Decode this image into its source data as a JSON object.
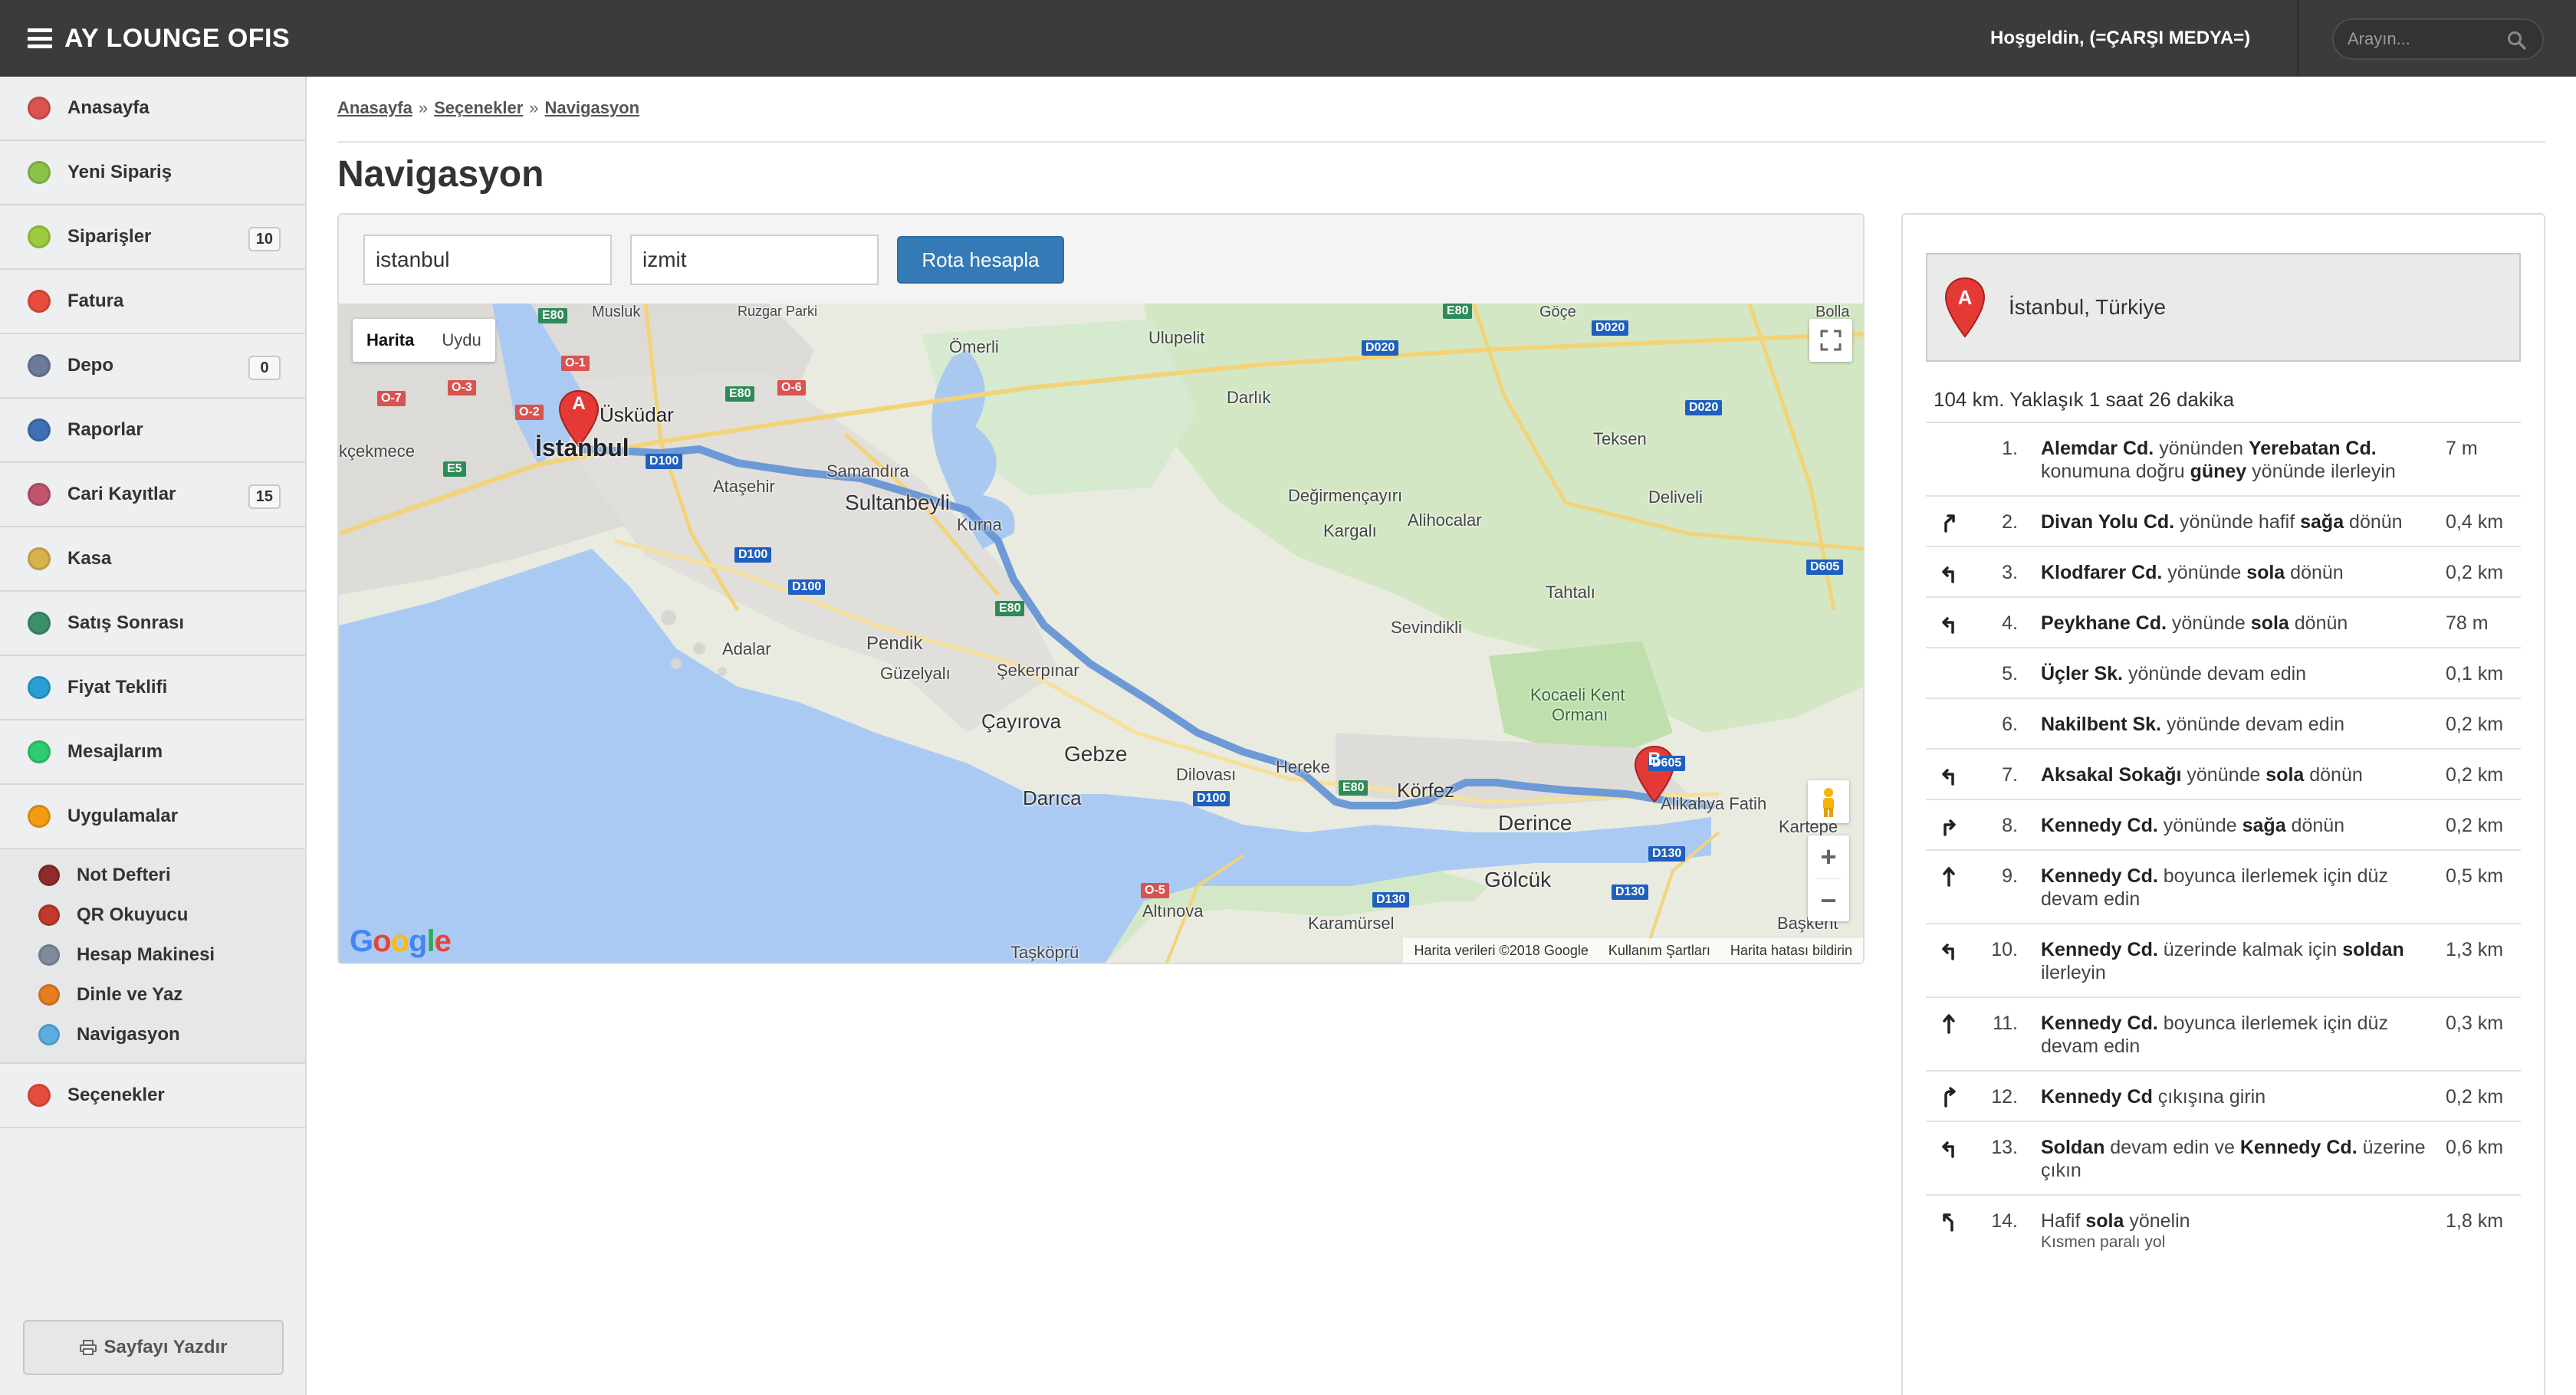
{
  "app": {
    "title": "AY LOUNGE OFIS",
    "welcome": "Hoşgeldin, (=ÇARŞI MEDYA=)",
    "search_placeholder": "Arayın..."
  },
  "sidebar": {
    "items": [
      {
        "label": "Anasayfa",
        "icon": "home-icon",
        "color": "#d9534f"
      },
      {
        "label": "Yeni Sipariş",
        "icon": "new-order-icon",
        "color": "#8bc34a"
      },
      {
        "label": "Siparişler",
        "icon": "orders-icon",
        "color": "#9ccc3d",
        "badge": "10"
      },
      {
        "label": "Fatura",
        "icon": "invoice-icon",
        "color": "#e74c3c"
      },
      {
        "label": "Depo",
        "icon": "warehouse-icon",
        "color": "#6c7a9c",
        "badge": "0"
      },
      {
        "label": "Raporlar",
        "icon": "reports-icon",
        "color": "#3f6fb5"
      },
      {
        "label": "Cari Kayıtlar",
        "icon": "accounts-icon",
        "color": "#c0546b",
        "badge": "15"
      },
      {
        "label": "Kasa",
        "icon": "cash-icon",
        "color": "#d8b24c"
      },
      {
        "label": "Satış Sonrası",
        "icon": "after-sales-icon",
        "color": "#3b8f6b"
      },
      {
        "label": "Fiyat Teklifi",
        "icon": "price-quote-icon",
        "color": "#2a9fd6"
      },
      {
        "label": "Mesajlarım",
        "icon": "messages-icon",
        "color": "#2ecc71"
      },
      {
        "label": "Uygulamalar",
        "icon": "apps-icon",
        "color": "#f39c12"
      }
    ],
    "sub_items": [
      {
        "label": "Not Defteri",
        "icon": "notebook-icon",
        "color": "#8e2b2b"
      },
      {
        "label": "QR Okuyucu",
        "icon": "qr-reader-icon",
        "color": "#c0392b"
      },
      {
        "label": "Hesap Makinesi",
        "icon": "calculator-icon",
        "color": "#7f8c9b"
      },
      {
        "label": "Dinle ve Yaz",
        "icon": "listen-write-icon",
        "color": "#e67e22"
      },
      {
        "label": "Navigasyon",
        "icon": "navigation-icon",
        "color": "#5dade2"
      }
    ],
    "settings_label": "Seçenekler",
    "settings_color": "#e74c3c",
    "print_label": "Sayfayı Yazdır"
  },
  "breadcrumb": [
    "Anasayfa",
    "Seçenekler",
    "Navigasyon"
  ],
  "page_title": "Navigasyon",
  "route_form": {
    "origin": "istanbul",
    "destination": "izmit",
    "button": "Rota hesapla"
  },
  "map": {
    "type_map": "Harita",
    "type_satellite": "Uydu",
    "google": "Google",
    "footer": [
      "Harita verileri ©2018 Google",
      "Kullanım Şartları",
      "Harita hatası bildirin"
    ],
    "marker_a": "A",
    "marker_b": "B",
    "places": {
      "istanbul": "İstanbul",
      "uskudar": "Üsküdar",
      "cekmece": "kçekmece",
      "atasehir": "Ataşehir",
      "samandira": "Samandıra",
      "sultanbeyli": "Sultanbeyli",
      "kurna": "Kurna",
      "omerli": "Ömerli",
      "ulupelit": "Ulupelit",
      "darlik": "Darlık",
      "goce": "Göçe",
      "teksen": "Teksen",
      "degirmencayiri": "Değirmençayırı",
      "kargali": "Kargalı",
      "alihocalar": "Alihocalar",
      "deliveli": "Deliveli",
      "tahtali": "Tahtalı",
      "sevindikli": "Sevindikli",
      "pendik": "Pendik",
      "adalar": "Adalar",
      "guzelyali": "Güzelyalı",
      "sekerpinar": "Şekerpınar",
      "cayirova": "Çayırova",
      "gebze": "Gebze",
      "darica": "Darıca",
      "dilovasi": "Dilovası",
      "hereke": "Hereke",
      "korfez": "Körfez",
      "derince": "Derince",
      "kocaeli": "Kocaeli Kent",
      "ormani": "Ormanı",
      "alikahya": "Alikahya Fatih",
      "kartepe": "Kartepe",
      "golcuk": "Gölcük",
      "altinova": "Altınova",
      "karamursel": "Karamürsel",
      "taskopru": "Taşköprü",
      "baskent": "Başkent",
      "bolla": "Bolla",
      "ruzgar": "Ruzgar Parki",
      "musluk": "Musluk"
    },
    "roads": {
      "e80a": "E80",
      "e80b": "E80",
      "e80c": "E80",
      "e5": "E5",
      "d100a": "D100",
      "d100b": "D100",
      "d100c": "D100",
      "d100d": "D100",
      "o1": "O-1",
      "o2": "O-2",
      "o3": "O-3",
      "o5": "O-5",
      "o6": "O-6",
      "o7": "O-7",
      "d020a": "D020",
      "d020b": "D020",
      "d020c": "D020",
      "d605a": "D605",
      "d605b": "D605",
      "d130a": "D130",
      "d130b": "D130",
      "d130c": "D130",
      "e80d": "E80",
      "e80e": "E80"
    }
  },
  "directions": {
    "origin": "İstanbul, Türkiye",
    "summary": "104 km. Yaklaşık 1 saat 26 dakika",
    "steps": [
      {
        "num": "1.",
        "turn": "none",
        "parts": [
          [
            "Alemdar Cd.",
            true
          ],
          [
            " yönünden ",
            false
          ],
          [
            "Yerebatan Cd.",
            true
          ],
          [
            " konumuna doğru ",
            false
          ],
          [
            "güney",
            true
          ],
          [
            " yönünde ilerleyin",
            false
          ]
        ],
        "dist": "7 m"
      },
      {
        "num": "2.",
        "turn": "slight-right",
        "parts": [
          [
            "Divan Yolu Cd.",
            true
          ],
          [
            " yönünde hafif ",
            false
          ],
          [
            "sağa",
            true
          ],
          [
            " dönün",
            false
          ]
        ],
        "dist": "0,4 km"
      },
      {
        "num": "3.",
        "turn": "left",
        "parts": [
          [
            "Klodfarer Cd.",
            true
          ],
          [
            " yönünde ",
            false
          ],
          [
            "sola",
            true
          ],
          [
            " dönün",
            false
          ]
        ],
        "dist": "0,2 km"
      },
      {
        "num": "4.",
        "turn": "left",
        "parts": [
          [
            "Peykhane Cd.",
            true
          ],
          [
            " yönünde ",
            false
          ],
          [
            "sola",
            true
          ],
          [
            " dönün",
            false
          ]
        ],
        "dist": "78 m"
      },
      {
        "num": "5.",
        "turn": "none",
        "parts": [
          [
            "Üçler Sk.",
            true
          ],
          [
            " yönünde devam edin",
            false
          ]
        ],
        "dist": "0,1 km"
      },
      {
        "num": "6.",
        "turn": "none",
        "parts": [
          [
            "Nakilbent Sk.",
            true
          ],
          [
            " yönünde devam edin",
            false
          ]
        ],
        "dist": "0,2 km"
      },
      {
        "num": "7.",
        "turn": "left",
        "parts": [
          [
            "Aksakal Sokağı",
            true
          ],
          [
            " yönünde ",
            false
          ],
          [
            "sola",
            true
          ],
          [
            " dönün",
            false
          ]
        ],
        "dist": "0,2 km"
      },
      {
        "num": "8.",
        "turn": "right",
        "parts": [
          [
            "Kennedy Cd.",
            true
          ],
          [
            " yönünde ",
            false
          ],
          [
            "sağa",
            true
          ],
          [
            " dönün",
            false
          ]
        ],
        "dist": "0,2 km"
      },
      {
        "num": "9.",
        "turn": "straight",
        "parts": [
          [
            "Kennedy Cd.",
            true
          ],
          [
            " boyunca ilerlemek için düz devam edin",
            false
          ]
        ],
        "dist": "0,5 km"
      },
      {
        "num": "10.",
        "turn": "left",
        "parts": [
          [
            "Kennedy Cd.",
            true
          ],
          [
            " üzerinde kalmak için ",
            false
          ],
          [
            "soldan",
            true
          ],
          [
            " ilerleyin",
            false
          ]
        ],
        "dist": "1,3 km"
      },
      {
        "num": "11.",
        "turn": "straight",
        "parts": [
          [
            "Kennedy Cd.",
            true
          ],
          [
            " boyunca ilerlemek için düz devam edin",
            false
          ]
        ],
        "dist": "0,3 km"
      },
      {
        "num": "12.",
        "turn": "ramp-right",
        "parts": [
          [
            "Kennedy Cd",
            true
          ],
          [
            " çıkışına girin",
            false
          ]
        ],
        "dist": "0,2 km"
      },
      {
        "num": "13.",
        "turn": "left",
        "parts": [
          [
            "Soldan",
            true
          ],
          [
            " devam edin ve ",
            false
          ],
          [
            "Kennedy Cd.",
            true
          ],
          [
            " üzerine çıkın",
            false
          ]
        ],
        "dist": "0,6 km"
      },
      {
        "num": "14.",
        "turn": "slight-left",
        "parts": [
          [
            "Hafif ",
            false
          ],
          [
            "sola",
            true
          ],
          [
            " yönelin",
            false
          ]
        ],
        "note": "Kısmen paralı yol",
        "dist": "1,8 km"
      }
    ]
  }
}
